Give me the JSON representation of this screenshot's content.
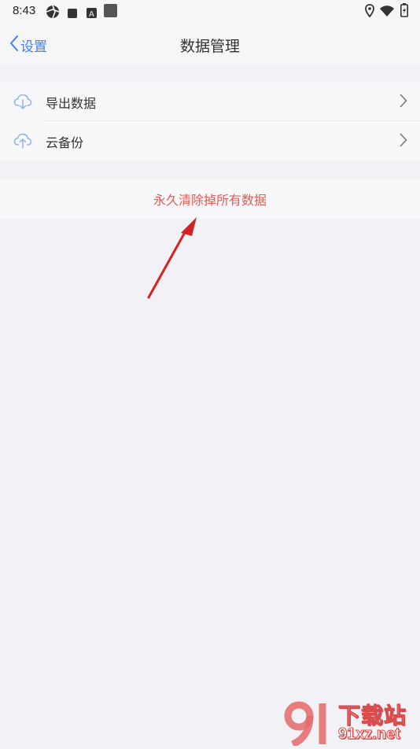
{
  "status_bar": {
    "time": "8:43",
    "left_icons": [
      "aperture-icon",
      "square-icon",
      "font-a-icon",
      "app-square-icon"
    ],
    "right_icons": [
      "location-icon",
      "wifi-icon",
      "battery-icon"
    ]
  },
  "nav": {
    "back_label": "设置",
    "title": "数据管理"
  },
  "settings": {
    "items": [
      {
        "label": "导出数据",
        "icon": "cloud-download-icon"
      },
      {
        "label": "云备份",
        "icon": "cloud-upload-icon"
      }
    ]
  },
  "danger": {
    "label": "永久清除掉所有数据"
  },
  "watermark": {
    "cn": "下载站",
    "en": "91xz.net"
  },
  "colors": {
    "accent": "#3d7ef0",
    "danger": "#e45a55",
    "background": "#f2f1f6",
    "annotation_arrow": "#d42323"
  }
}
